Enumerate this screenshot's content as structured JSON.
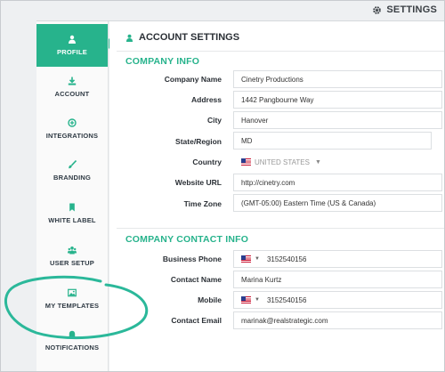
{
  "header": {
    "title": "SETTINGS"
  },
  "sidebar": {
    "items": [
      {
        "label": "PROFILE",
        "icon": "user-icon",
        "active": true
      },
      {
        "label": "ACCOUNT",
        "icon": "download-icon",
        "active": false
      },
      {
        "label": "INTEGRATIONS",
        "icon": "plus-circle-icon",
        "active": false
      },
      {
        "label": "BRANDING",
        "icon": "brush-icon",
        "active": false
      },
      {
        "label": "WHITE LABEL",
        "icon": "bookmark-icon",
        "active": false
      },
      {
        "label": "USER SETUP",
        "icon": "users-icon",
        "active": false
      },
      {
        "label": "MY TEMPLATES",
        "icon": "image-icon",
        "active": false
      },
      {
        "label": "NOTIFICATIONS",
        "icon": "bell-icon",
        "active": false
      }
    ]
  },
  "page": {
    "title": "ACCOUNT SETTINGS"
  },
  "company_info": {
    "title": "COMPANY INFO",
    "labels": {
      "company_name": "Company Name",
      "address": "Address",
      "city": "City",
      "state": "State/Region",
      "country": "Country",
      "website": "Website URL",
      "timezone": "Time Zone"
    },
    "values": {
      "company_name": "Cinetry Productions",
      "address": "1442 Pangbourne Way",
      "city": "Hanover",
      "state": "MD",
      "country": "UNITED STATES",
      "website": "http://cinetry.com",
      "timezone": "(GMT-05:00) Eastern Time (US & Canada)"
    }
  },
  "contact_info": {
    "title": "COMPANY CONTACT INFO",
    "labels": {
      "business_phone": "Business Phone",
      "contact_name": "Contact Name",
      "mobile": "Mobile",
      "contact_email": "Contact Email"
    },
    "values": {
      "business_phone": "3152540156",
      "contact_name": "Marina Kurtz",
      "mobile": "3152540156",
      "contact_email": "marinak@realstrategic.com"
    }
  },
  "colors": {
    "accent": "#27b38c",
    "annotation": "#2bb89a"
  }
}
